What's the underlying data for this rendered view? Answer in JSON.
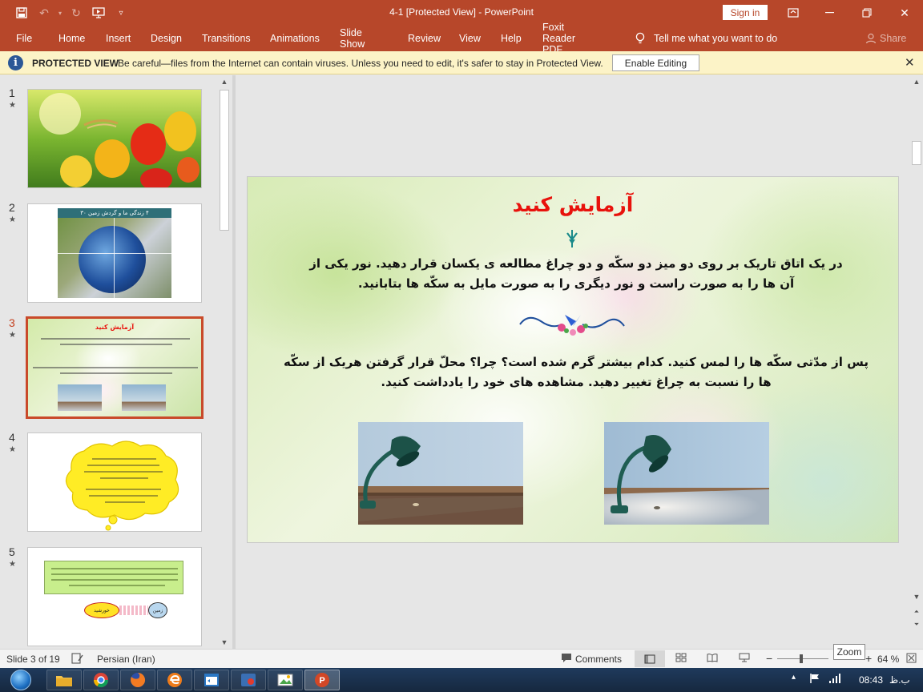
{
  "titlebar": {
    "doc_title": "4-1 [Protected View]  -  PowerPoint",
    "sign_in": "Sign in"
  },
  "ribbon": {
    "tabs": [
      "File",
      "Home",
      "Insert",
      "Design",
      "Transitions",
      "Animations",
      "Slide Show",
      "Review",
      "View",
      "Help",
      "Foxit Reader PDF"
    ],
    "tell_me": "Tell me what you want to do",
    "share": "Share"
  },
  "protected_view": {
    "label": "PROTECTED VIEW",
    "message": "Be careful—files from the Internet can contain viruses. Unless you need to edit, it's safer to stay in Protected View.",
    "enable_button": "Enable Editing"
  },
  "thumbnails": [
    {
      "number": "1",
      "star": "★"
    },
    {
      "number": "2",
      "star": "★"
    },
    {
      "number": "3",
      "star": "★"
    },
    {
      "number": "4",
      "star": "★"
    },
    {
      "number": "5",
      "star": "★"
    }
  ],
  "slide": {
    "title": "آزمایش کنید",
    "paragraph1": "در یک اتاق تاریک بر روی دو میز دو سکّه و دو چراغ مطالعه ی یکسان قرار دهید. نور یکی از آن ها را به صورت راست و نور دیگری را به صورت مایل به سکّه ها بتابانید.",
    "paragraph2": "پس از مدّتی سکّه ها را لمس کنید. کدام بیشتر گرم شده است؟ چرا؟ محلّ قرار گرفتن هریک از سکّه ها را نسبت به چراغ تغییر دهید. مشاهده های خود را یادداشت کنید."
  },
  "thumb2": {
    "banner": "۴  زندگی ما و گردش زمین ۳۰"
  },
  "thumb5": {
    "box1": "خورشید",
    "box2": "زمین"
  },
  "statusbar": {
    "slide_counter": "Slide 3 of 19",
    "language": "Persian (Iran)",
    "comments": "Comments",
    "zoom_level": "64 %",
    "zoom_tooltip": "Zoom"
  },
  "taskbar": {
    "clock": "08:43",
    "ampm": "ب.ظ"
  },
  "colors": {
    "accent": "#b7472a",
    "slide_title": "#e8120c",
    "protected_bar": "#fcf3c7",
    "active_thumb_border": "#c94a2a"
  }
}
